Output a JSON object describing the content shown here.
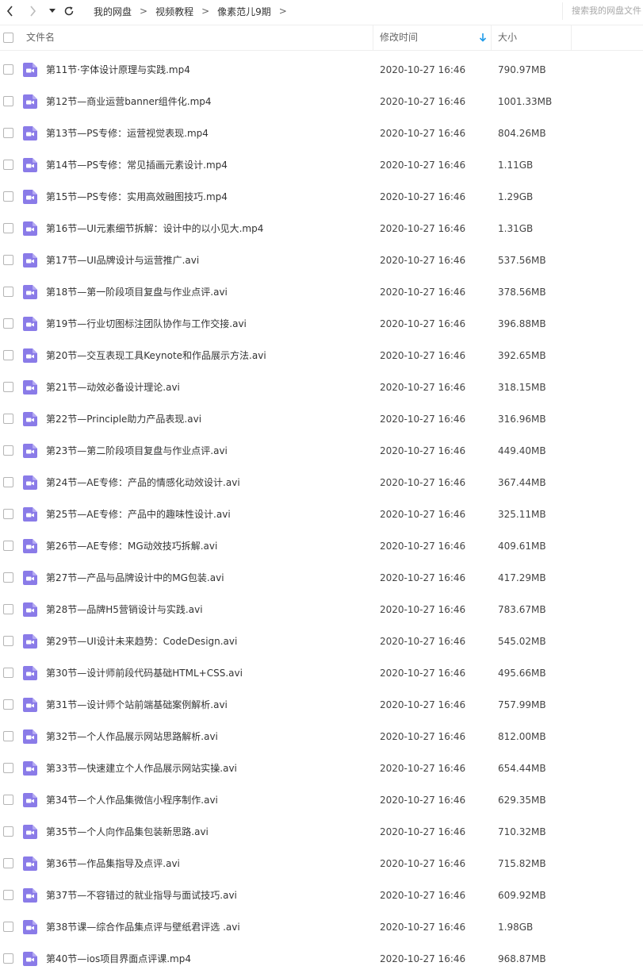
{
  "toolbar": {
    "back_icon": "chevron-left-icon",
    "forward_icon": "chevron-right-icon",
    "history_icon": "caret-down-icon",
    "refresh_icon": "refresh-icon",
    "breadcrumbs": [
      "我的网盘",
      "视频教程",
      "像素范儿9期"
    ],
    "separator": ">",
    "search_placeholder": "搜索我的网盘文件"
  },
  "header": {
    "name_label": "文件名",
    "time_label": "修改时间",
    "size_label": "大小",
    "sort_icon": "sort-down-arrow-icon",
    "accent_color": "#1e9bea"
  },
  "file_icon_color": "#8a7be8",
  "files": [
    {
      "name": "第11节·字体设计原理与实践.mp4",
      "time": "2020-10-27 16:46",
      "size": "790.97MB"
    },
    {
      "name": "第12节—商业运营banner组件化.mp4",
      "time": "2020-10-27 16:46",
      "size": "1001.33MB"
    },
    {
      "name": "第13节—PS专修：运营视觉表现.mp4",
      "time": "2020-10-27 16:46",
      "size": "804.26MB"
    },
    {
      "name": "第14节—PS专修：常见插画元素设计.mp4",
      "time": "2020-10-27 16:46",
      "size": "1.11GB"
    },
    {
      "name": "第15节—PS专修：实用高效融图技巧.mp4",
      "time": "2020-10-27 16:46",
      "size": "1.29GB"
    },
    {
      "name": "第16节—UI元素细节拆解：设计中的以小见大.mp4",
      "time": "2020-10-27 16:46",
      "size": "1.31GB"
    },
    {
      "name": "第17节—UI品牌设计与运营推广.avi",
      "time": "2020-10-27 16:46",
      "size": "537.56MB"
    },
    {
      "name": "第18节—第一阶段项目复盘与作业点评.avi",
      "time": "2020-10-27 16:46",
      "size": "378.56MB"
    },
    {
      "name": "第19节—行业切图标注团队协作与工作交接.avi",
      "time": "2020-10-27 16:46",
      "size": "396.88MB"
    },
    {
      "name": "第20节—交互表现工具Keynote和作品展示方法.avi",
      "time": "2020-10-27 16:46",
      "size": "392.65MB"
    },
    {
      "name": "第21节—动效必备设计理论.avi",
      "time": "2020-10-27 16:46",
      "size": "318.15MB"
    },
    {
      "name": "第22节—Principle助力产品表现.avi",
      "time": "2020-10-27 16:46",
      "size": "316.96MB"
    },
    {
      "name": "第23节—第二阶段项目复盘与作业点评.avi",
      "time": "2020-10-27 16:46",
      "size": "449.40MB"
    },
    {
      "name": "第24节—AE专修：产品的情感化动效设计.avi",
      "time": "2020-10-27 16:46",
      "size": "367.44MB"
    },
    {
      "name": "第25节—AE专修：产品中的趣味性设计.avi",
      "time": "2020-10-27 16:46",
      "size": "325.11MB"
    },
    {
      "name": "第26节—AE专修：MG动效技巧拆解.avi",
      "time": "2020-10-27 16:46",
      "size": "409.61MB"
    },
    {
      "name": "第27节—产品与品牌设计中的MG包装.avi",
      "time": "2020-10-27 16:46",
      "size": "417.29MB"
    },
    {
      "name": "第28节—品牌H5营销设计与实践.avi",
      "time": "2020-10-27 16:46",
      "size": "783.67MB"
    },
    {
      "name": "第29节—UI设计未来趋势：CodeDesign.avi",
      "time": "2020-10-27 16:46",
      "size": "545.02MB"
    },
    {
      "name": "第30节—设计师前段代码基础HTML+CSS.avi",
      "time": "2020-10-27 16:46",
      "size": "495.66MB"
    },
    {
      "name": "第31节—设计师个站前端基础案例解析.avi",
      "time": "2020-10-27 16:46",
      "size": "757.99MB"
    },
    {
      "name": "第32节—个人作品展示网站思路解析.avi",
      "time": "2020-10-27 16:46",
      "size": "812.00MB"
    },
    {
      "name": "第33节—快速建立个人作品展示网站实操.avi",
      "time": "2020-10-27 16:46",
      "size": "654.44MB"
    },
    {
      "name": "第34节—个人作品集微信小程序制作.avi",
      "time": "2020-10-27 16:46",
      "size": "629.35MB"
    },
    {
      "name": "第35节—个人向作品集包装新思路.avi",
      "time": "2020-10-27 16:46",
      "size": "710.32MB"
    },
    {
      "name": "第36节—作品集指导及点评.avi",
      "time": "2020-10-27 16:46",
      "size": "715.82MB"
    },
    {
      "name": "第37节—不容错过的就业指导与面试技巧.avi",
      "time": "2020-10-27 16:46",
      "size": "609.92MB"
    },
    {
      "name": "第38节课—综合作品集点评与壁纸君评选 .avi",
      "time": "2020-10-27 16:46",
      "size": "1.98GB"
    },
    {
      "name": "第40节—ios项目界面点评课.mp4",
      "time": "2020-10-27 16:46",
      "size": "968.87MB"
    }
  ]
}
